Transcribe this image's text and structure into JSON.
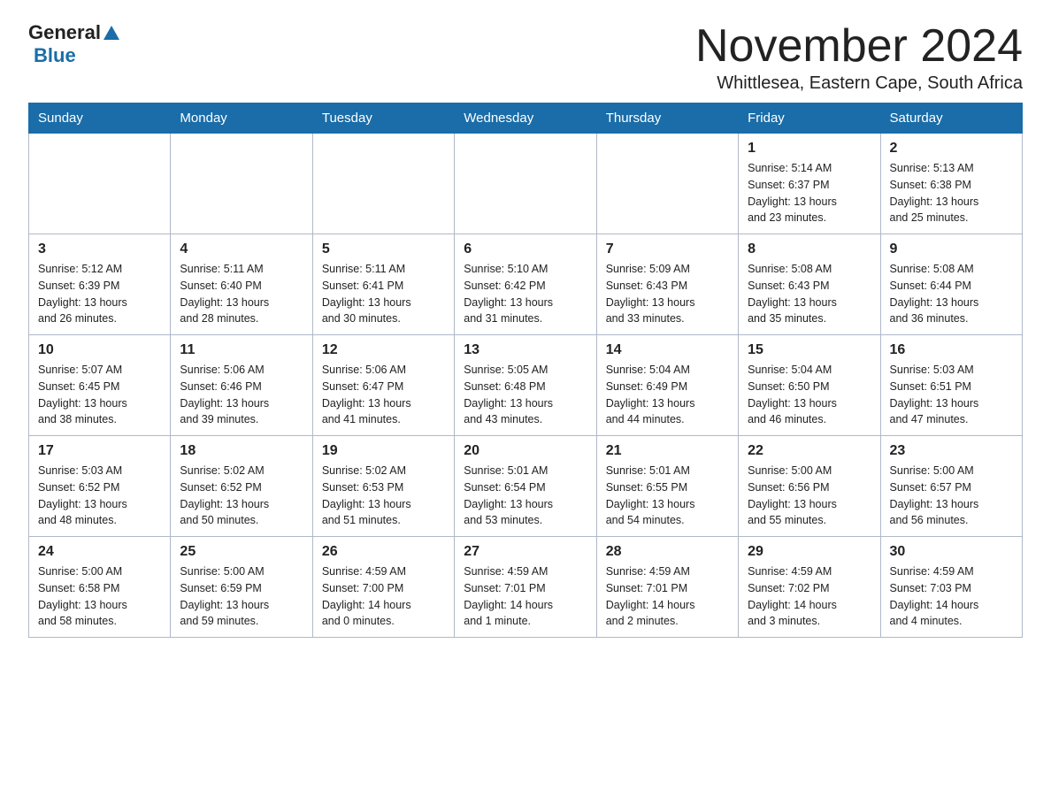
{
  "logo": {
    "general": "General",
    "blue": "Blue"
  },
  "header": {
    "month": "November 2024",
    "location": "Whittlesea, Eastern Cape, South Africa"
  },
  "days_of_week": [
    "Sunday",
    "Monday",
    "Tuesday",
    "Wednesday",
    "Thursday",
    "Friday",
    "Saturday"
  ],
  "weeks": [
    [
      {
        "day": "",
        "info": ""
      },
      {
        "day": "",
        "info": ""
      },
      {
        "day": "",
        "info": ""
      },
      {
        "day": "",
        "info": ""
      },
      {
        "day": "",
        "info": ""
      },
      {
        "day": "1",
        "info": "Sunrise: 5:14 AM\nSunset: 6:37 PM\nDaylight: 13 hours\nand 23 minutes."
      },
      {
        "day": "2",
        "info": "Sunrise: 5:13 AM\nSunset: 6:38 PM\nDaylight: 13 hours\nand 25 minutes."
      }
    ],
    [
      {
        "day": "3",
        "info": "Sunrise: 5:12 AM\nSunset: 6:39 PM\nDaylight: 13 hours\nand 26 minutes."
      },
      {
        "day": "4",
        "info": "Sunrise: 5:11 AM\nSunset: 6:40 PM\nDaylight: 13 hours\nand 28 minutes."
      },
      {
        "day": "5",
        "info": "Sunrise: 5:11 AM\nSunset: 6:41 PM\nDaylight: 13 hours\nand 30 minutes."
      },
      {
        "day": "6",
        "info": "Sunrise: 5:10 AM\nSunset: 6:42 PM\nDaylight: 13 hours\nand 31 minutes."
      },
      {
        "day": "7",
        "info": "Sunrise: 5:09 AM\nSunset: 6:43 PM\nDaylight: 13 hours\nand 33 minutes."
      },
      {
        "day": "8",
        "info": "Sunrise: 5:08 AM\nSunset: 6:43 PM\nDaylight: 13 hours\nand 35 minutes."
      },
      {
        "day": "9",
        "info": "Sunrise: 5:08 AM\nSunset: 6:44 PM\nDaylight: 13 hours\nand 36 minutes."
      }
    ],
    [
      {
        "day": "10",
        "info": "Sunrise: 5:07 AM\nSunset: 6:45 PM\nDaylight: 13 hours\nand 38 minutes."
      },
      {
        "day": "11",
        "info": "Sunrise: 5:06 AM\nSunset: 6:46 PM\nDaylight: 13 hours\nand 39 minutes."
      },
      {
        "day": "12",
        "info": "Sunrise: 5:06 AM\nSunset: 6:47 PM\nDaylight: 13 hours\nand 41 minutes."
      },
      {
        "day": "13",
        "info": "Sunrise: 5:05 AM\nSunset: 6:48 PM\nDaylight: 13 hours\nand 43 minutes."
      },
      {
        "day": "14",
        "info": "Sunrise: 5:04 AM\nSunset: 6:49 PM\nDaylight: 13 hours\nand 44 minutes."
      },
      {
        "day": "15",
        "info": "Sunrise: 5:04 AM\nSunset: 6:50 PM\nDaylight: 13 hours\nand 46 minutes."
      },
      {
        "day": "16",
        "info": "Sunrise: 5:03 AM\nSunset: 6:51 PM\nDaylight: 13 hours\nand 47 minutes."
      }
    ],
    [
      {
        "day": "17",
        "info": "Sunrise: 5:03 AM\nSunset: 6:52 PM\nDaylight: 13 hours\nand 48 minutes."
      },
      {
        "day": "18",
        "info": "Sunrise: 5:02 AM\nSunset: 6:52 PM\nDaylight: 13 hours\nand 50 minutes."
      },
      {
        "day": "19",
        "info": "Sunrise: 5:02 AM\nSunset: 6:53 PM\nDaylight: 13 hours\nand 51 minutes."
      },
      {
        "day": "20",
        "info": "Sunrise: 5:01 AM\nSunset: 6:54 PM\nDaylight: 13 hours\nand 53 minutes."
      },
      {
        "day": "21",
        "info": "Sunrise: 5:01 AM\nSunset: 6:55 PM\nDaylight: 13 hours\nand 54 minutes."
      },
      {
        "day": "22",
        "info": "Sunrise: 5:00 AM\nSunset: 6:56 PM\nDaylight: 13 hours\nand 55 minutes."
      },
      {
        "day": "23",
        "info": "Sunrise: 5:00 AM\nSunset: 6:57 PM\nDaylight: 13 hours\nand 56 minutes."
      }
    ],
    [
      {
        "day": "24",
        "info": "Sunrise: 5:00 AM\nSunset: 6:58 PM\nDaylight: 13 hours\nand 58 minutes."
      },
      {
        "day": "25",
        "info": "Sunrise: 5:00 AM\nSunset: 6:59 PM\nDaylight: 13 hours\nand 59 minutes."
      },
      {
        "day": "26",
        "info": "Sunrise: 4:59 AM\nSunset: 7:00 PM\nDaylight: 14 hours\nand 0 minutes."
      },
      {
        "day": "27",
        "info": "Sunrise: 4:59 AM\nSunset: 7:01 PM\nDaylight: 14 hours\nand 1 minute."
      },
      {
        "day": "28",
        "info": "Sunrise: 4:59 AM\nSunset: 7:01 PM\nDaylight: 14 hours\nand 2 minutes."
      },
      {
        "day": "29",
        "info": "Sunrise: 4:59 AM\nSunset: 7:02 PM\nDaylight: 14 hours\nand 3 minutes."
      },
      {
        "day": "30",
        "info": "Sunrise: 4:59 AM\nSunset: 7:03 PM\nDaylight: 14 hours\nand 4 minutes."
      }
    ]
  ]
}
